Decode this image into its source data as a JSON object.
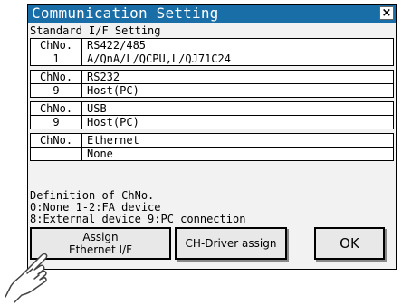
{
  "window": {
    "title": "Communication Setting",
    "subtitle": "Standard I/F Setting",
    "close_label": "×"
  },
  "channels": [
    {
      "ch_header": "ChNo.",
      "interface": "RS422/485",
      "ch_value": "1",
      "driver": "A/QnA/L/QCPU,L/QJ71C24"
    },
    {
      "ch_header": "ChNo.",
      "interface": "RS232",
      "ch_value": "9",
      "driver": "Host(PC)"
    },
    {
      "ch_header": "ChNo.",
      "interface": "USB",
      "ch_value": "9",
      "driver": "Host(PC)"
    },
    {
      "ch_header": "ChNo.",
      "interface": "Ethernet",
      "ch_value": "",
      "driver": "None"
    }
  ],
  "definitions": {
    "line1": "Definition of ChNo.",
    "line2": "0:None 1-2:FA device",
    "line3": "8:External device 9:PC connection"
  },
  "buttons": {
    "assign_ethernet": [
      "Assign",
      "Ethernet I/F"
    ],
    "ch_driver": "CH-Driver assign",
    "ok": "OK"
  },
  "colors": {
    "titlebar": "#1a6ea8",
    "background": "#f2f2f2"
  }
}
